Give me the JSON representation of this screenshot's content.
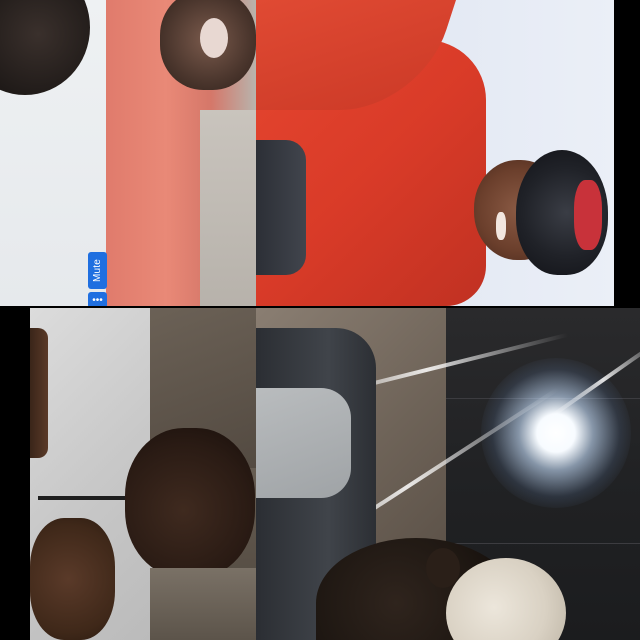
{
  "app": {
    "layout": "gallery-view",
    "tiles": [
      {
        "id": "participant-1",
        "description_kind": "video"
      },
      {
        "id": "participant-2",
        "description_kind": "video"
      },
      {
        "id": "participant-3",
        "description_kind": "video"
      },
      {
        "id": "participant-4",
        "description_kind": "video"
      }
    ]
  },
  "controls": {
    "mute_label": "Mute",
    "more_label": "•••",
    "accent_color": "#1f6fe0"
  },
  "icons": {
    "more": "more-options-icon"
  }
}
